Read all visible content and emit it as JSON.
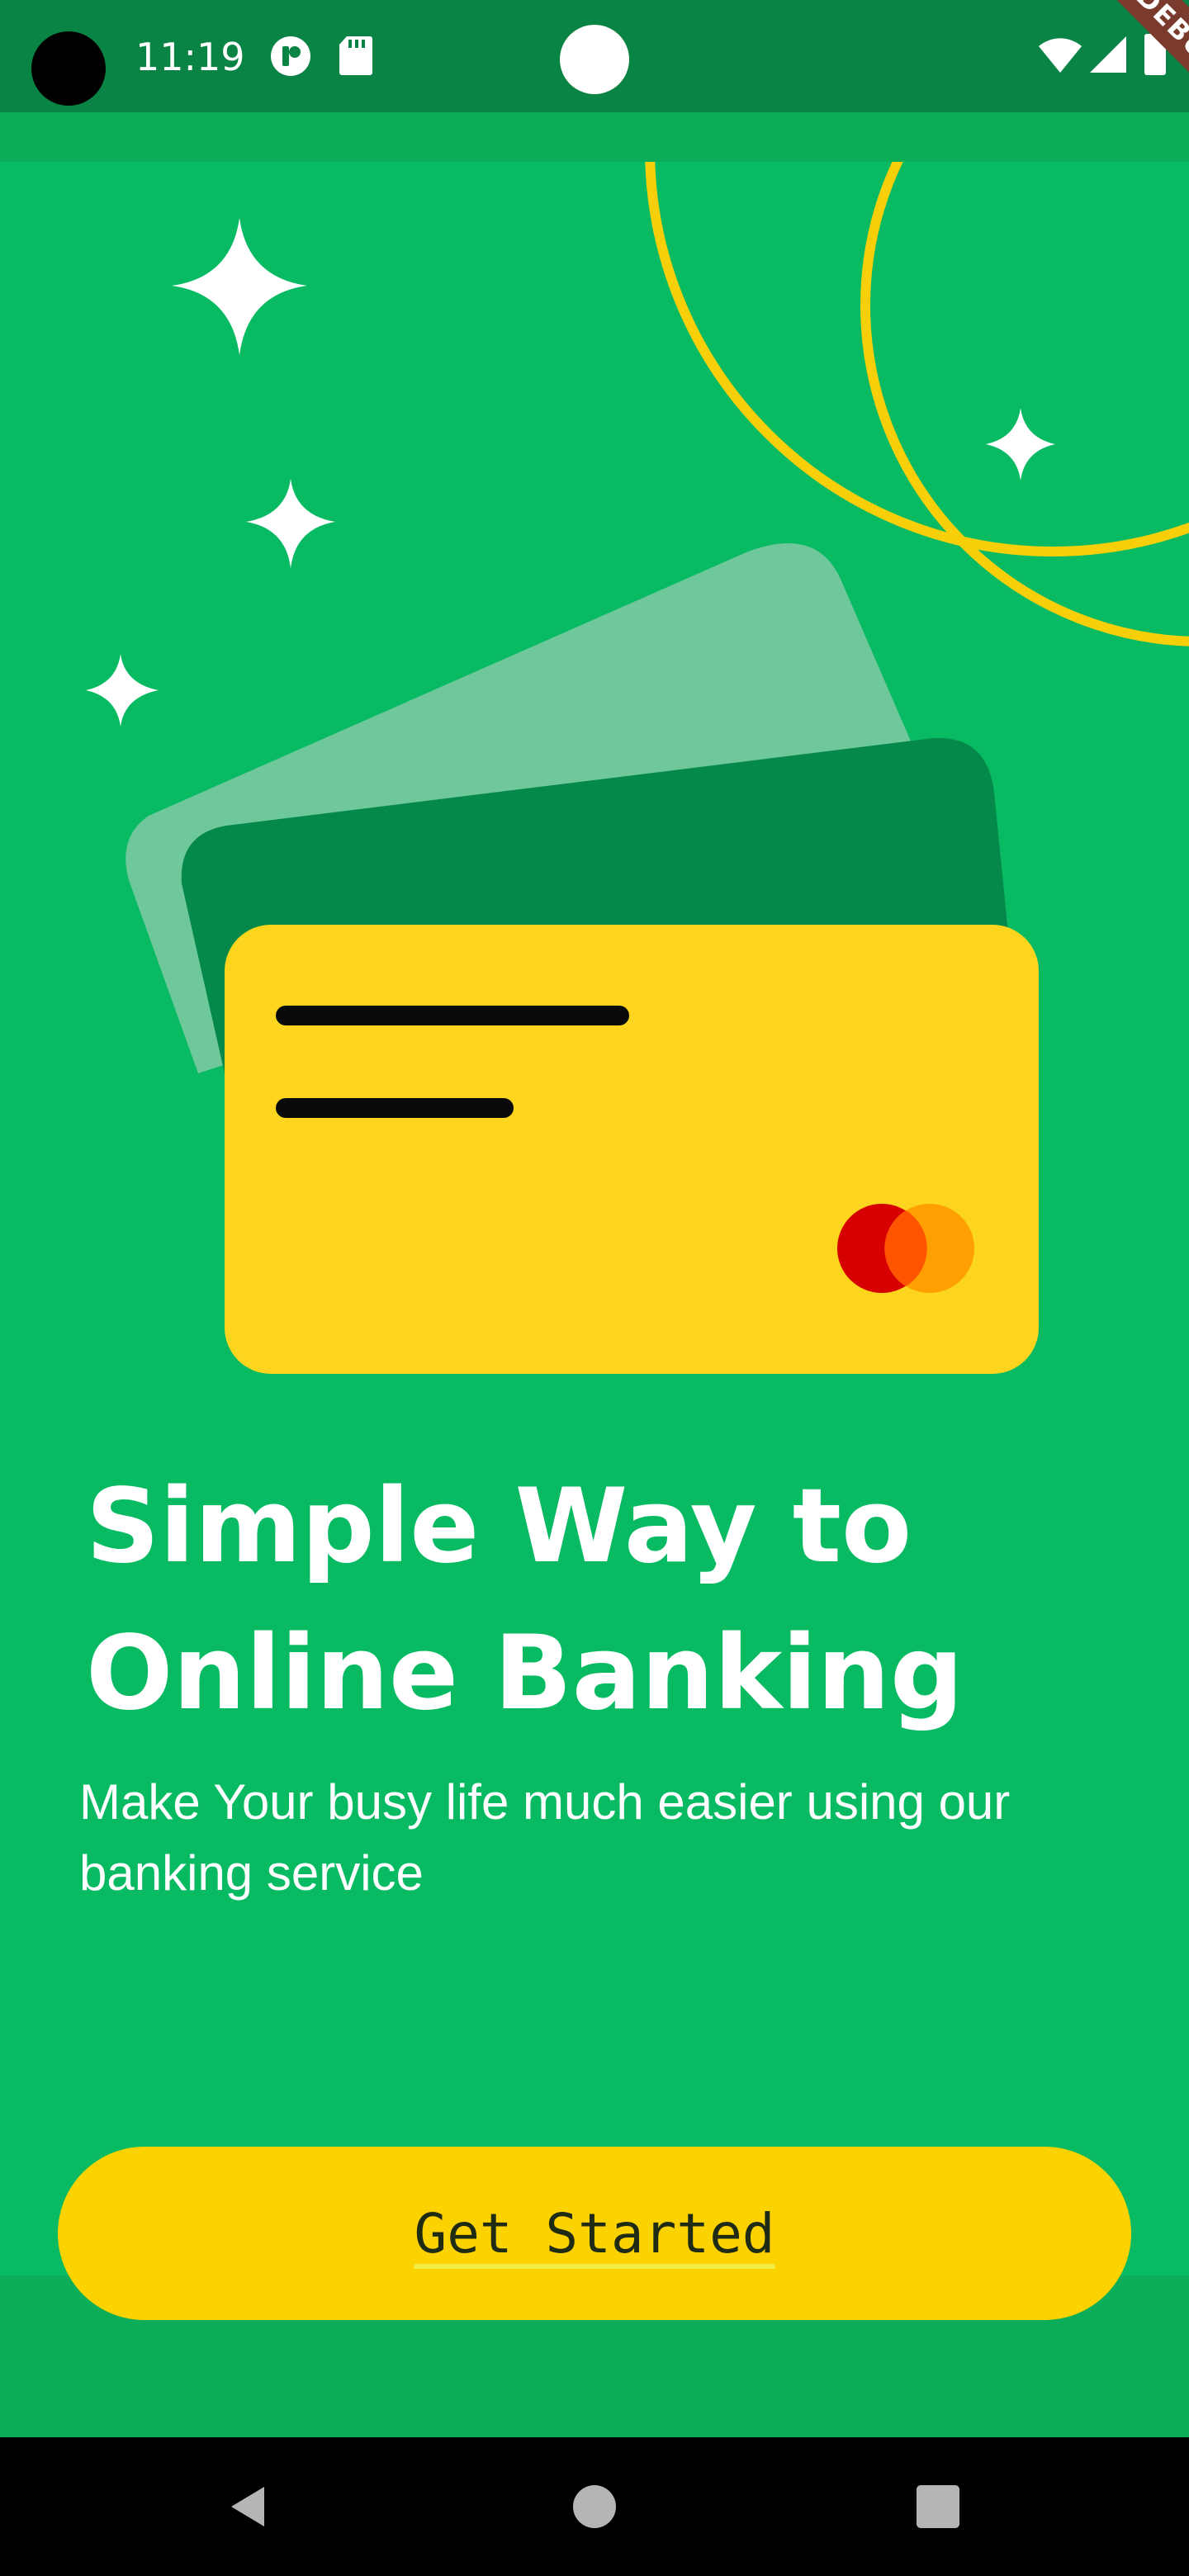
{
  "status_bar": {
    "time": "11:19",
    "icons": [
      "camera-cutout-icon",
      "app-notification-icon",
      "sd-card-icon",
      "wifi-icon",
      "signal-icon",
      "battery-icon"
    ],
    "debug_banner": "DEBUG"
  },
  "hero": {
    "title_line1": "Simple Way to",
    "title_line2": "Online Banking",
    "subtitle": "Make Your busy life much easier using our banking service"
  },
  "cta": {
    "label": "Get Started"
  },
  "nav": {
    "buttons": [
      "back-icon",
      "home-icon",
      "recents-icon"
    ]
  },
  "colors": {
    "background": "#08bb63",
    "status_bar": "#0a8445",
    "accent_yellow": "#fcd200",
    "card_dark_green": "#04894a",
    "card_light_green": "#6fc79c"
  }
}
